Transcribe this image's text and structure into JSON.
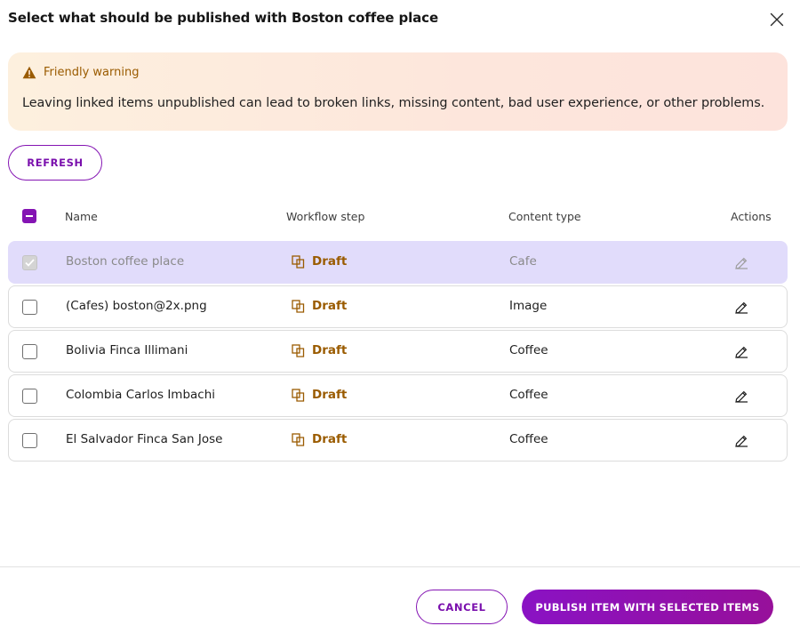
{
  "dialog": {
    "title": "Select what should be published with Boston coffee place"
  },
  "warning": {
    "title": "Friendly warning",
    "text": "Leaving linked items unpublished can lead to broken links, missing content, bad user experience, or other problems."
  },
  "toolbar": {
    "refresh_label": "REFRESH"
  },
  "table": {
    "headers": {
      "name": "Name",
      "workflow": "Workflow step",
      "content_type": "Content type",
      "actions": "Actions"
    },
    "rows": [
      {
        "name": "Boston coffee place",
        "workflow": "Draft",
        "content_type": "Cafe"
      },
      {
        "name": "(Cafes) boston@2x.png",
        "workflow": "Draft",
        "content_type": "Image"
      },
      {
        "name": "Bolivia Finca Illimani",
        "workflow": "Draft",
        "content_type": "Coffee"
      },
      {
        "name": "Colombia Carlos Imbachi",
        "workflow": "Draft",
        "content_type": "Coffee"
      },
      {
        "name": "El Salvador Finca San Jose",
        "workflow": "Draft",
        "content_type": "Coffee"
      }
    ]
  },
  "footer": {
    "cancel_label": "CANCEL",
    "publish_label": "PUBLISH ITEM WITH SELECTED ITEMS"
  },
  "icons": {
    "close": "close-icon",
    "warning": "warning-triangle-icon",
    "workflow": "workflow-step-icon",
    "edit": "edit-pencil-icon"
  },
  "colors": {
    "accent": "#8414b3",
    "warning_text": "#9a5b00",
    "selected_row": "#e1dcfb"
  }
}
